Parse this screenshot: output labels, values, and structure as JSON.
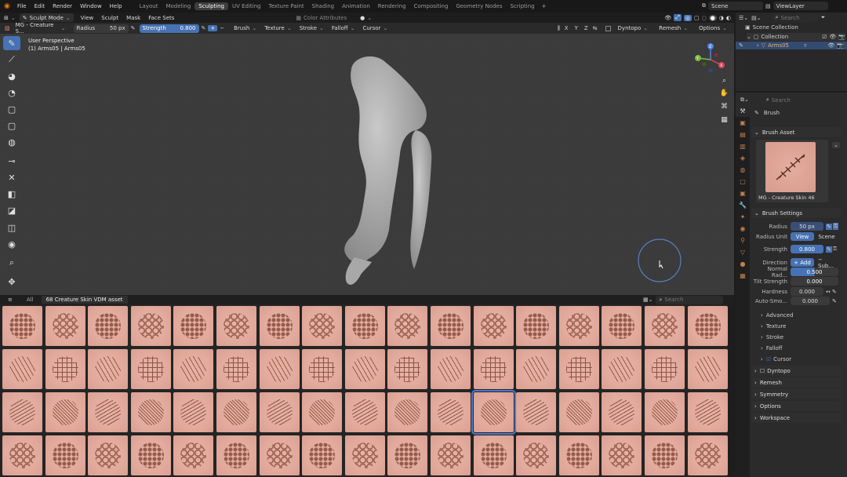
{
  "topbar": {
    "menus": [
      "File",
      "Edit",
      "Render",
      "Window",
      "Help"
    ],
    "workspaces": [
      "Layout",
      "Modeling",
      "Sculpting",
      "UV Editing",
      "Texture Paint",
      "Shading",
      "Animation",
      "Rendering",
      "Compositing",
      "Geometry Nodes",
      "Scripting"
    ],
    "active_workspace": "Sculpting",
    "add": "+",
    "scene": "Scene",
    "view_layer": "ViewLayer"
  },
  "header": {
    "mode": "Sculpt Mode",
    "menus": [
      "View",
      "Sculpt",
      "Mask",
      "Face Sets"
    ],
    "color_attributes": "Color Attributes"
  },
  "tool_header": {
    "brush_name": "MG - Creature S...",
    "radius_label": "Radius",
    "radius_value": "50 px",
    "strength_label": "Strength",
    "strength_value": "0.800",
    "minus": "−",
    "plus": "+",
    "menus": [
      "Brush",
      "Texture",
      "Stroke",
      "Falloff",
      "Cursor"
    ],
    "axes": [
      "X",
      "Y",
      "Z"
    ],
    "dyntopo": "Dyntopo",
    "remesh": "Remesh",
    "options": "Options"
  },
  "viewport": {
    "perspective": "User Perspective",
    "object": "(1) Arms05 | Arms05"
  },
  "gizmo": {
    "x": "X",
    "y": "Y",
    "z": "Z"
  },
  "asset_browser": {
    "all": "All",
    "catalog": "68 Creature Skin VDM asset",
    "search_placeholder": "Search"
  },
  "outliner": {
    "search_placeholder": "Search",
    "scene_collection": "Scene Collection",
    "collection": "Collection",
    "object": "Arms05"
  },
  "properties": {
    "search_placeholder": "Search",
    "brush_title": "Brush",
    "brush_asset_title": "Brush Asset",
    "asset_name": "MG - Creature Skin 46",
    "brush_settings_title": "Brush Settings",
    "radius_label": "Radius",
    "radius_value": "50 px",
    "radius_unit_label": "Radius Unit",
    "radius_unit_view": "View",
    "radius_unit_scene": "Scene",
    "strength_label": "Strength",
    "strength_value": "0.800",
    "direction_label": "Direction",
    "direction_add": "+ Add",
    "direction_sub": "− Sub...",
    "normal_radius_label": "Normal Rad...",
    "normal_radius_value": "0.500",
    "tilt_strength_label": "Tilt Strength",
    "tilt_strength_value": "0.000",
    "hardness_label": "Hardness",
    "hardness_value": "0.000",
    "autosmooth_label": "Auto-Smo...",
    "autosmooth_value": "0.000",
    "subpanels": [
      "Advanced",
      "Texture",
      "Stroke",
      "Falloff",
      "Cursor"
    ],
    "panels": [
      "Dyntopo",
      "Remesh",
      "Symmetry",
      "Options",
      "Workspace"
    ]
  },
  "colors": {
    "accent": "#4772b3",
    "tile": "#e2aa9c",
    "texture": "#6b3a2c"
  },
  "tool_icons": [
    "draw-brush-icon",
    "draw-sharp-icon",
    "clay-icon",
    "clay-strips-icon",
    "layer-icon",
    "inflate-icon",
    "blob-icon",
    "crease-icon",
    "pinch-icon",
    "grab-icon",
    "snake-hook-icon",
    "thumb-icon",
    "smooth-icon",
    "zoom-icon",
    "move-icon",
    "transform-icon"
  ],
  "tile_rows": 4,
  "tile_cols": 17,
  "selected_tile": "2-11"
}
